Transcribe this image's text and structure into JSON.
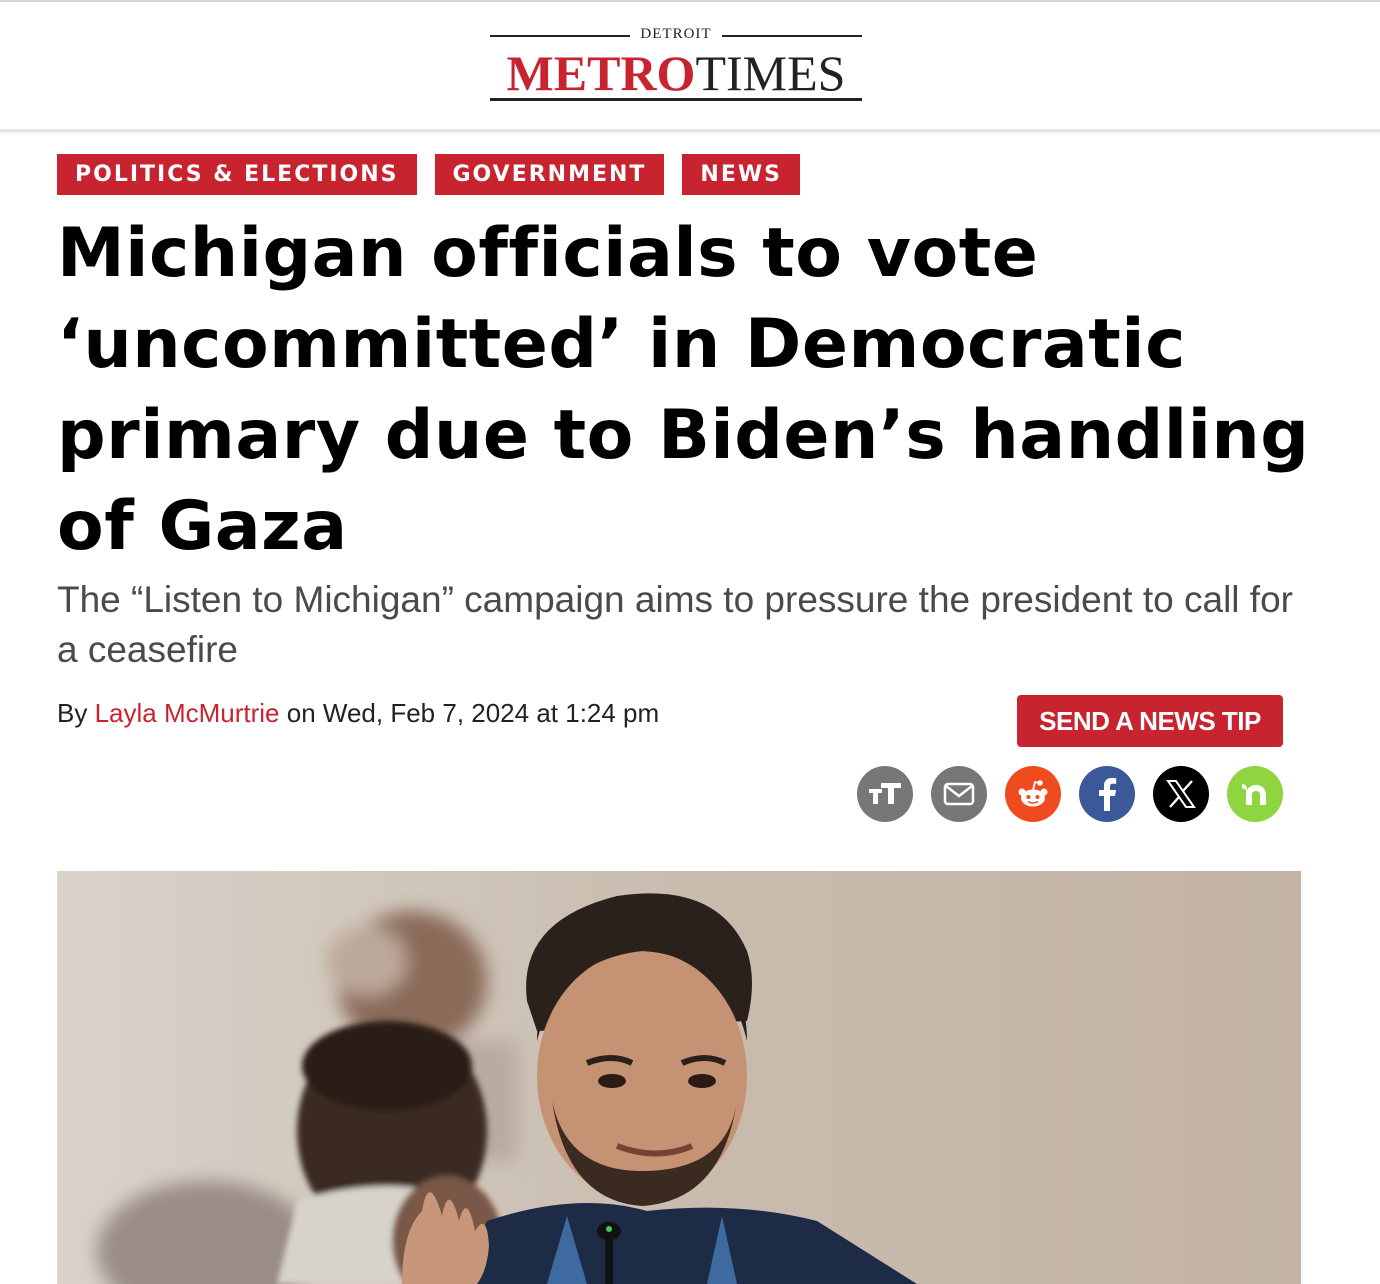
{
  "site": {
    "logo_kicker": "DETROIT",
    "logo_metro": "METRO",
    "logo_times": "TIMES"
  },
  "article": {
    "tags": [
      "POLITICS & ELECTIONS",
      "GOVERNMENT",
      "NEWS"
    ],
    "headline": "Michigan officials to vote ‘uncommitted’ in Democratic primary due to Biden’s handling of Gaza",
    "subhead": "The “Listen to Michigan” campaign aims to pressure the president to call for a ceasefire",
    "byline_prefix": "By ",
    "author": "Layla McMurtrie",
    "byline_middle": " on ",
    "date": "Wed, Feb 7, 2024 at 1:24 pm"
  },
  "actions": {
    "news_tip_label": "SEND A NEWS TIP"
  },
  "share_icons": [
    "text-size-icon",
    "email-icon",
    "reddit-icon",
    "facebook-icon",
    "x-icon",
    "nextdoor-icon"
  ],
  "colors": {
    "brand_red": "#c8242f",
    "reddit": "#f04a1f",
    "facebook": "#3b5998",
    "x": "#000000",
    "nextdoor": "#8ed53f",
    "icon_gray": "#777777"
  }
}
